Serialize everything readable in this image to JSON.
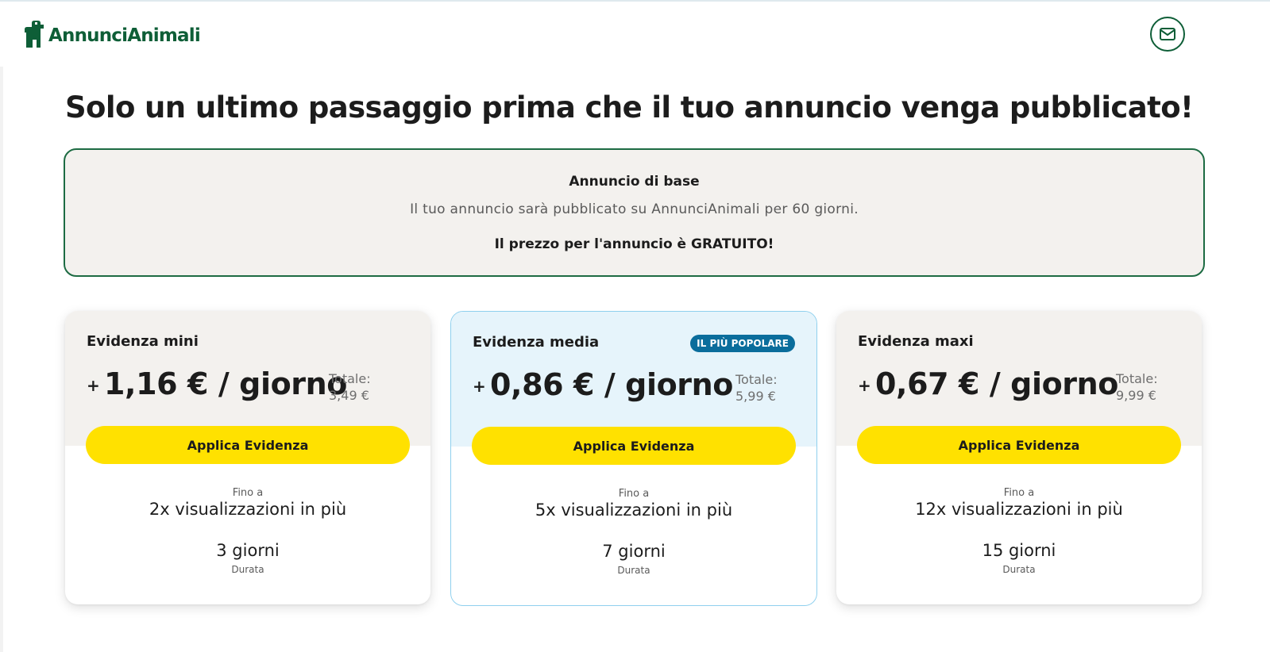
{
  "brand": {
    "name": "AnnunciAnimali",
    "color": "#0e5e37"
  },
  "header": {
    "mail_icon": "envelope-icon"
  },
  "page_title": "Solo un ultimo passaggio prima che il tuo annuncio venga pubblicato!",
  "base_ad": {
    "title": "Annuncio di base",
    "description": "Il tuo annuncio sarà pubblicato su AnnunciAnimali per 60 giorni.",
    "price_text": "Il prezzo per l'annuncio è GRATUITO!"
  },
  "plans": [
    {
      "name": "Evidenza mini",
      "plus": "+",
      "price": "1,16 € / giorno",
      "total_label": "Totale:",
      "total_value": "3,49 €",
      "button_label": "Applica Evidenza",
      "views_prefix": "Fino a",
      "views": "2x visualizzazioni in più",
      "days": "3 giorni",
      "duration_label": "Durata"
    },
    {
      "name": "Evidenza media",
      "badge": "IL PIÙ POPOLARE",
      "plus": "+",
      "price": "0,86 € / giorno",
      "total_label": "Totale:",
      "total_value": "5,99 €",
      "button_label": "Applica Evidenza",
      "views_prefix": "Fino a",
      "views": "5x visualizzazioni in più",
      "days": "7 giorni",
      "duration_label": "Durata"
    },
    {
      "name": "Evidenza maxi",
      "plus": "+",
      "price": "0,67 € / giorno",
      "total_label": "Totale:",
      "total_value": "9,99 €",
      "button_label": "Applica Evidenza",
      "views_prefix": "Fino a",
      "views": "12x visualizzazioni in più",
      "days": "15 giorni",
      "duration_label": "Durata"
    }
  ],
  "colors": {
    "accent_yellow": "#ffe100",
    "badge_blue": "#0a6d9c",
    "featured_bg": "#e6f4fb",
    "card_top_bg": "#f3f1ee"
  }
}
